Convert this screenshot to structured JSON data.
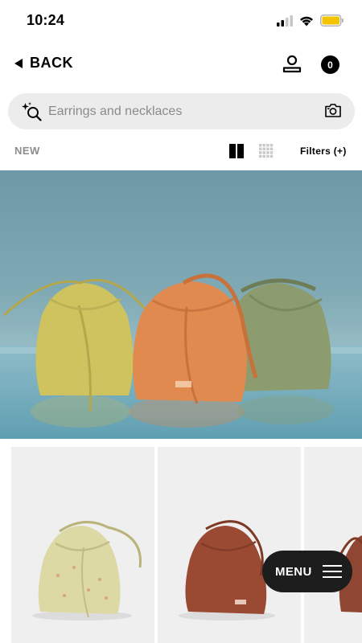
{
  "status_bar": {
    "time": "10:24",
    "icons": [
      "signal-icon",
      "wifi-icon",
      "battery-icon"
    ],
    "battery_color": "#f5c400"
  },
  "nav": {
    "back_label": "BACK",
    "user_icon": "user-icon",
    "cart_count": "0"
  },
  "search": {
    "placeholder": "Earrings and necklaces",
    "left_icon": "ai-search-icon",
    "right_icon": "camera-icon"
  },
  "toolbar": {
    "section_label": "NEW",
    "view_options": [
      "two-column-view-icon",
      "grid-view-icon"
    ],
    "filters_label": "Filters (+)"
  },
  "hero": {
    "image": "three bucket bags: yellow, orange, green"
  },
  "products": [
    {
      "image": "yellow bucket bag"
    },
    {
      "image": "brown bucket bag"
    },
    {
      "image": "brown bucket bag (partial)"
    }
  ],
  "menu": {
    "label": "MENU",
    "icon": "hamburger-icon"
  }
}
